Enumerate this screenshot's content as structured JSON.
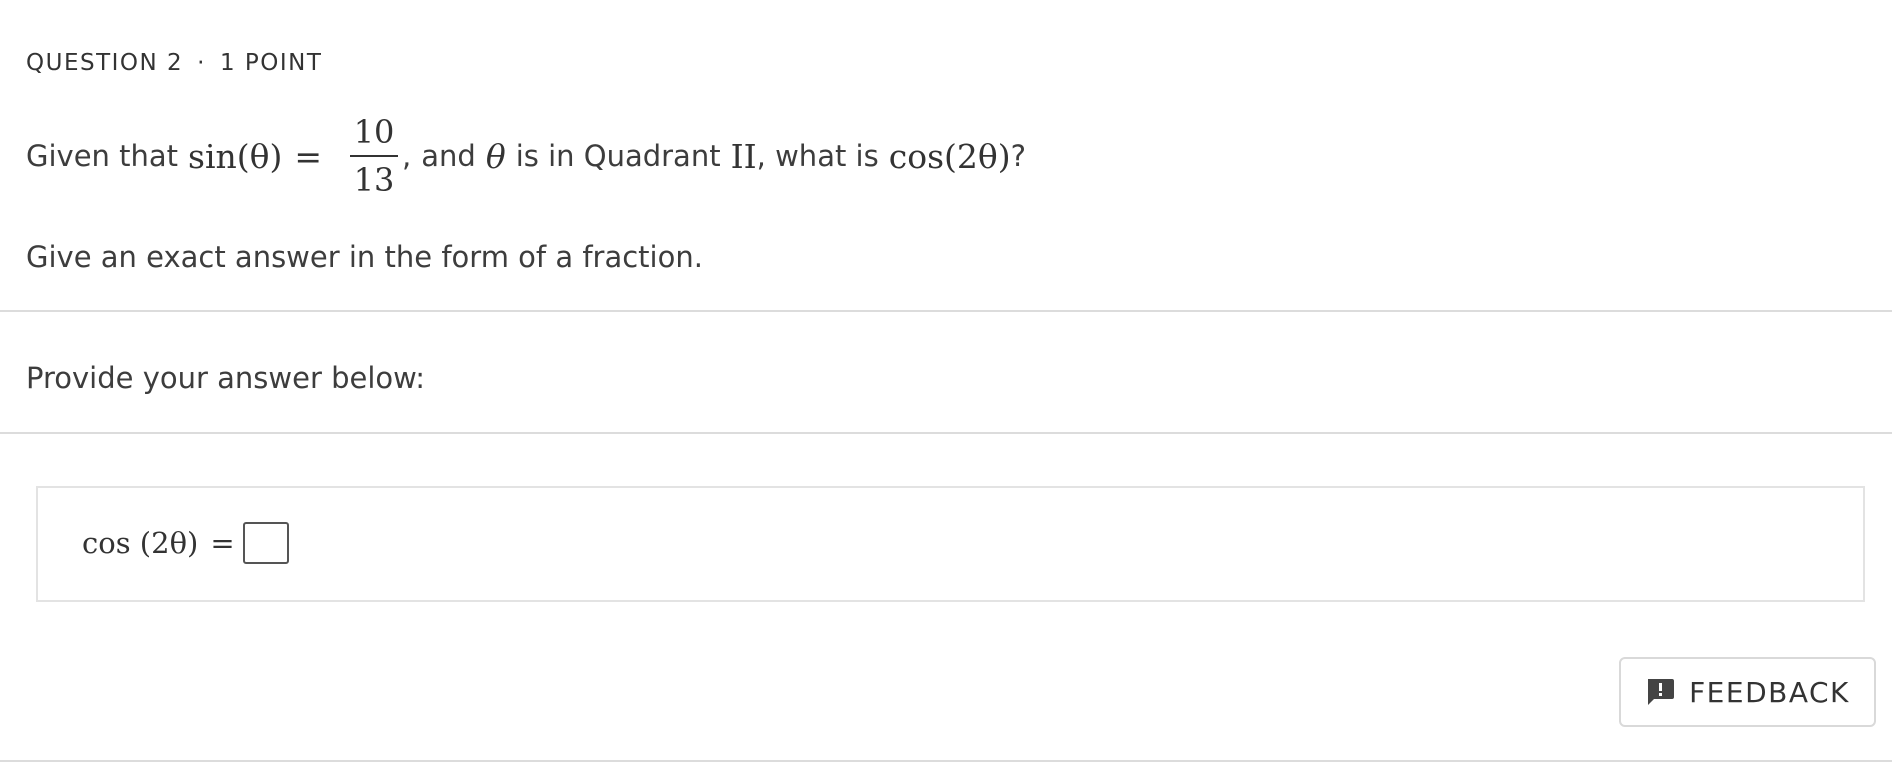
{
  "question": {
    "number": "QUESTION 2",
    "separator": "·",
    "points": "1 POINT"
  },
  "prompt": {
    "given_that": "Given that",
    "sin_theta": "sin(θ)",
    "equals": "=",
    "numerator": "10",
    "denominator": "13",
    "comma": ",",
    "and_text": "and",
    "theta": "θ",
    "is_in_quadrant": "is in Quadrant",
    "quadrant": "II",
    "what_is": ", what is",
    "target": "cos(2θ)",
    "question_mark": "?"
  },
  "instruction": "Give an exact answer in the form of a fraction.",
  "provide_label": "Provide your answer below:",
  "answer": {
    "expression": "cos (2θ)",
    "equals": "=",
    "value": ""
  },
  "feedback": {
    "label": "FEEDBACK",
    "icon": "feedback-icon"
  }
}
